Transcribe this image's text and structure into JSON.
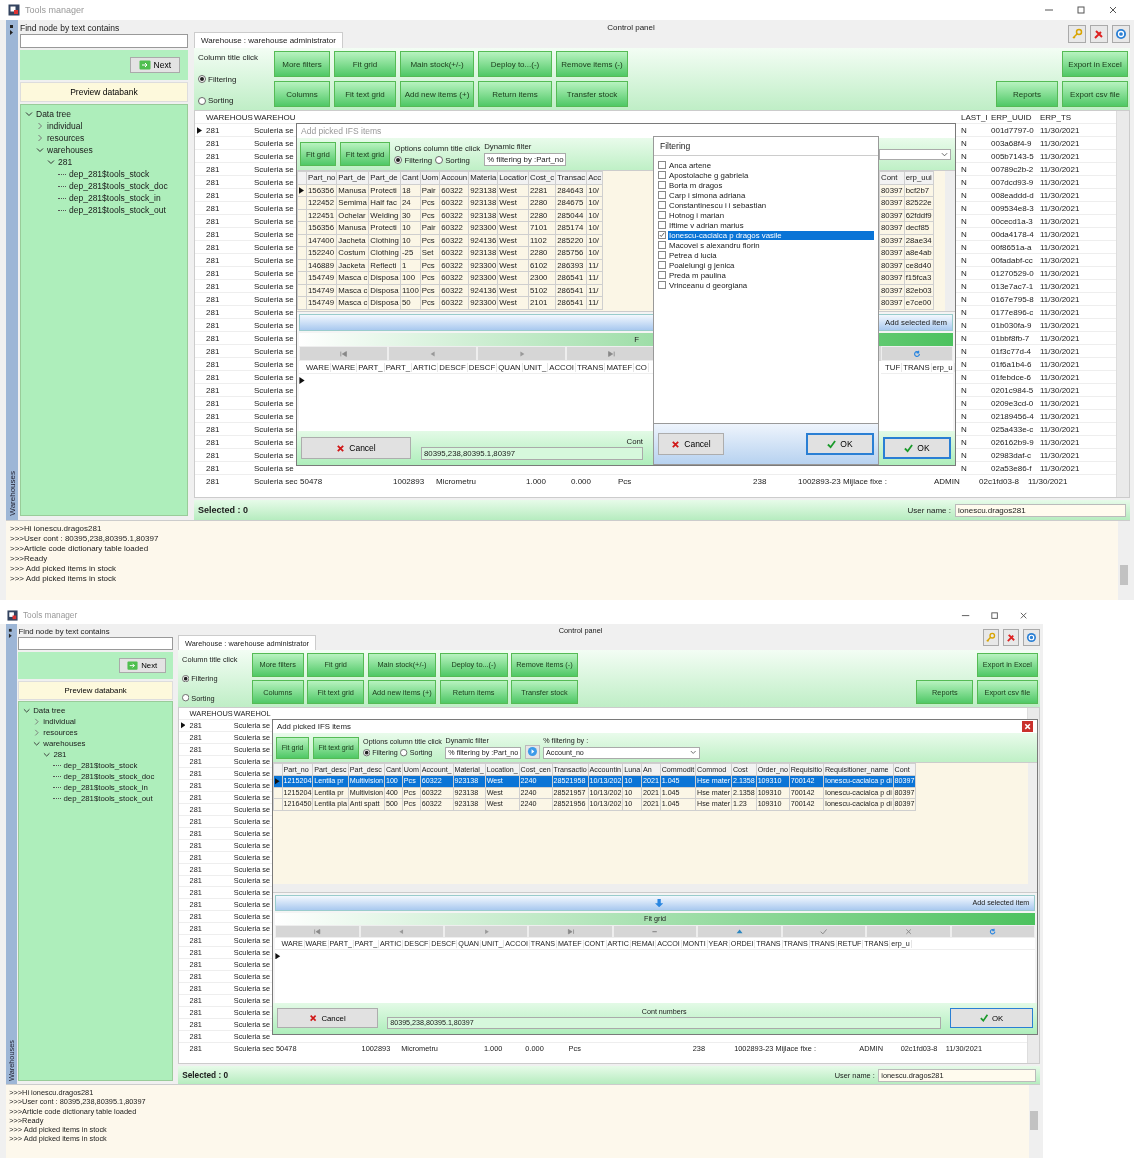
{
  "screens": [
    {
      "title": "Tools manager",
      "strip_label": "Warehouses",
      "sidebar": {
        "find_label": "Find node by text contains",
        "next_label": "Next",
        "preview_label": "Preview databank",
        "tree": [
          {
            "label": "Data tree",
            "expanded": true,
            "children": [
              {
                "label": "individual",
                "expanded": false
              },
              {
                "label": "resources",
                "expanded": false
              },
              {
                "label": "warehouses",
                "expanded": true,
                "children": [
                  {
                    "label": "281",
                    "expanded": true,
                    "children": [
                      {
                        "label": "dep_281$tools_stock"
                      },
                      {
                        "label": "dep_281$tools_stock_doc"
                      },
                      {
                        "label": "dep_281$tools_stock_in"
                      },
                      {
                        "label": "dep_281$tools_stock_out"
                      }
                    ]
                  }
                ]
              }
            ]
          }
        ]
      },
      "panel_title": "Control panel",
      "tab": "Warehouse : warehouse administrator",
      "sort_group": {
        "label": "Column title click",
        "options": [
          {
            "label": "Filtering",
            "selected": true
          },
          {
            "label": "Sorting",
            "selected": false
          }
        ]
      },
      "toolbar_buttons": [
        "More filters",
        "Fit grid",
        "Main stock(+/-)",
        "Deploy to...(-)",
        "Remove items (-)",
        "Columns",
        "Fit text grid",
        "Add new items (+)",
        "Return items",
        "Transfer stock"
      ],
      "side_buttons": [
        "Export in Excel",
        "Reports",
        "Export csv file"
      ],
      "grid": {
        "columns_left": [
          "WAREHOUS",
          "WAREHOU"
        ],
        "columns_right": [
          "LAST_I",
          "ERP_UUID",
          "ERP_TS"
        ],
        "rows": [
          {
            "current": true,
            "cells": [
              "281",
              "Sculeria se"
            ],
            "right": [
              "N",
              "001d7797-0",
              "11/30/2021"
            ]
          },
          {
            "current": false,
            "cells": [
              "281",
              "Sculeria se"
            ],
            "right": [
              "N",
              "003a68f4-9",
              "11/30/2021"
            ]
          },
          {
            "current": false,
            "cells": [
              "281",
              "Sculeria se"
            ],
            "right": [
              "N",
              "005b7143-5",
              "11/30/2021"
            ]
          },
          {
            "current": false,
            "cells": [
              "281",
              "Sculeria se"
            ],
            "right": [
              "N",
              "00789c2b-2",
              "11/30/2021"
            ]
          },
          {
            "current": false,
            "cells": [
              "281",
              "Sculeria se"
            ],
            "right": [
              "N",
              "007dcd93-9",
              "11/30/2021"
            ]
          },
          {
            "current": false,
            "cells": [
              "281",
              "Sculeria se"
            ],
            "right": [
              "N",
              "008eaddd-d",
              "11/30/2021"
            ]
          },
          {
            "current": false,
            "cells": [
              "281",
              "Sculeria se"
            ],
            "right": [
              "N",
              "009534e8-3",
              "11/30/2021"
            ]
          },
          {
            "current": false,
            "cells": [
              "281",
              "Sculeria se"
            ],
            "right": [
              "N",
              "00cecd1a-3",
              "11/30/2021"
            ]
          },
          {
            "current": false,
            "cells": [
              "281",
              "Sculeria se"
            ],
            "right": [
              "N",
              "00da4178-4",
              "11/30/2021"
            ]
          },
          {
            "current": false,
            "cells": [
              "281",
              "Sculeria se"
            ],
            "right": [
              "N",
              "00f8651a-a",
              "11/30/2021"
            ]
          },
          {
            "current": false,
            "cells": [
              "281",
              "Sculeria se"
            ],
            "right": [
              "N",
              "00fadabf-cc",
              "11/30/2021"
            ]
          },
          {
            "current": false,
            "cells": [
              "281",
              "Sculeria se"
            ],
            "right": [
              "N",
              "01270529-0",
              "11/30/2021"
            ]
          },
          {
            "current": false,
            "cells": [
              "281",
              "Sculeria se"
            ],
            "right": [
              "N",
              "013e7ac7-1",
              "11/30/2021"
            ]
          },
          {
            "current": false,
            "cells": [
              "281",
              "Sculeria se"
            ],
            "right": [
              "N",
              "0167e795-8",
              "11/30/2021"
            ]
          },
          {
            "current": false,
            "cells": [
              "281",
              "Sculeria se"
            ],
            "right": [
              "N",
              "0177e896-c",
              "11/30/2021"
            ]
          },
          {
            "current": false,
            "cells": [
              "281",
              "Sculeria se"
            ],
            "right": [
              "N",
              "01b030fa-9",
              "11/30/2021"
            ]
          },
          {
            "current": false,
            "cells": [
              "281",
              "Sculeria se"
            ],
            "right": [
              "N",
              "01bbf8fb-7",
              "11/30/2021"
            ]
          },
          {
            "current": false,
            "cells": [
              "281",
              "Sculeria se"
            ],
            "right": [
              "N",
              "01f3c77d-4",
              "11/30/2021"
            ]
          },
          {
            "current": false,
            "cells": [
              "281",
              "Sculeria se"
            ],
            "right": [
              "N",
              "01f6a1b4-6",
              "11/30/2021"
            ]
          },
          {
            "current": false,
            "cells": [
              "281",
              "Sculeria se"
            ],
            "right": [
              "N",
              "01febdce-6",
              "11/30/2021"
            ]
          },
          {
            "current": false,
            "cells": [
              "281",
              "Sculeria se"
            ],
            "right": [
              "N",
              "0201c984-5",
              "11/30/2021"
            ]
          },
          {
            "current": false,
            "cells": [
              "281",
              "Sculeria se"
            ],
            "right": [
              "N",
              "0209e3cd-0",
              "11/30/2021"
            ]
          },
          {
            "current": false,
            "cells": [
              "281",
              "Sculeria se"
            ],
            "right": [
              "N",
              "02189456-4",
              "11/30/2021"
            ]
          },
          {
            "current": false,
            "cells": [
              "281",
              "Sculeria se"
            ],
            "right": [
              "N",
              "025a433e-c",
              "11/30/2021"
            ]
          },
          {
            "current": false,
            "cells": [
              "281",
              "Sculeria se"
            ],
            "right": [
              "N",
              "026162b9-9",
              "11/30/2021"
            ]
          },
          {
            "current": false,
            "cells": [
              "281",
              "Sculeria se"
            ],
            "right": [
              "N",
              "02983daf-c",
              "11/30/2021"
            ]
          },
          {
            "current": false,
            "cells": [
              "281",
              "Sculeria se"
            ],
            "right": [
              "N",
              "02a53e86-f",
              "11/30/2021"
            ]
          }
        ],
        "last_row": [
          "281",
          "Sculeria sec",
          "50478",
          "1002893",
          "Micrometru",
          "1.000",
          "0.000",
          "Pcs",
          "238",
          "1002893-23 Mijlace fixe :",
          "ADMIN",
          "02c1fd03-8",
          "11/30/2021"
        ]
      },
      "selected_label": "Selected : 0",
      "user_label": "User name :",
      "user_value": "ionescu.dragos281",
      "log": [
        ">>>Hi ionescu.dragos281",
        ">>>User cont : 80395,238,80395.1,80397",
        ">>>Article code dictionary table loaded",
        ">>>Ready",
        ">>> Add picked items in stock",
        ">>> Add picked items in stock"
      ],
      "dialog": {
        "title": "Add picked IFS items",
        "active": false,
        "fit_buttons": [
          "Fit grid",
          "Fit text grid"
        ],
        "options_label": "Options column title click",
        "options": [
          {
            "label": "Filtering",
            "selected": true
          },
          {
            "label": "Sorting",
            "selected": false
          }
        ],
        "filter_label": "Dynamic filter",
        "filter_value": "% filtering by :Part_no",
        "columns": [
          "Part_no",
          "Part_de",
          "Part_de",
          "Cant",
          "Uom",
          "Accoun",
          "Materia",
          "Locatior",
          "Cost_c",
          "Transac",
          "Acc"
        ],
        "columns_after": [
          "Cont",
          "erp_uui"
        ],
        "rows": [
          {
            "current": true,
            "selected": false,
            "cells": [
              "156356",
              "Manusa",
              "Protecti",
              "18",
              "Pair",
              "60322",
              "923138",
              "West",
              "2281",
              "284643",
              "10/"
            ],
            "cells_after": [
              "80397",
              "bcf2b7"
            ]
          },
          {
            "current": false,
            "selected": false,
            "cells": [
              "122452",
              "Semima",
              "Half fac",
              "24",
              "Pcs",
              "60322",
              "923138",
              "West",
              "2280",
              "284675",
              "10/"
            ],
            "cells_after": [
              "80397",
              "82522e"
            ]
          },
          {
            "current": false,
            "selected": false,
            "cells": [
              "122451",
              "Ochelar",
              "Welding",
              "30",
              "Pcs",
              "60322",
              "923138",
              "West",
              "2280",
              "285044",
              "10/"
            ],
            "cells_after": [
              "80397",
              "62fddf9"
            ]
          },
          {
            "current": false,
            "selected": false,
            "cells": [
              "156356",
              "Manusa",
              "Protecti",
              "10",
              "Pair",
              "60322",
              "923300",
              "West",
              "7101",
              "285174",
              "10/"
            ],
            "cells_after": [
              "80397",
              "decf85"
            ]
          },
          {
            "current": false,
            "selected": false,
            "cells": [
              "147400",
              "Jacheta",
              "Clothing",
              "10",
              "Pcs",
              "60322",
              "924136",
              "West",
              "1102",
              "285220",
              "10/"
            ],
            "cells_after": [
              "80397",
              "28ae34"
            ]
          },
          {
            "current": false,
            "selected": false,
            "cells": [
              "152240",
              "Costum",
              "Clothing",
              "-25",
              "Set",
              "60322",
              "923138",
              "West",
              "2280",
              "285756",
              "10/"
            ],
            "cells_after": [
              "80397",
              "a8e4ab"
            ]
          },
          {
            "current": false,
            "selected": false,
            "cells": [
              "146889",
              "Jacketa",
              "Reflecti",
              "1",
              "Pcs",
              "60322",
              "923300",
              "West",
              "6102",
              "286393",
              "11/"
            ],
            "cells_after": [
              "80397",
              "ce8d40"
            ]
          },
          {
            "current": false,
            "selected": false,
            "cells": [
              "154749",
              "Masca c",
              "Disposa",
              "100",
              "Pcs",
              "60322",
              "923300",
              "West",
              "2300",
              "286541",
              "11/"
            ],
            "cells_after": [
              "80397",
              "f15fca3"
            ]
          },
          {
            "current": false,
            "selected": false,
            "cells": [
              "154749",
              "Masca c",
              "Disposa",
              "1100",
              "Pcs",
              "60322",
              "924136",
              "West",
              "5102",
              "286541",
              "11/"
            ],
            "cells_after": [
              "80397",
              "82eb03"
            ]
          },
          {
            "current": false,
            "selected": false,
            "cells": [
              "154749",
              "Masca c",
              "Disposa",
              "50",
              "Pcs",
              "60322",
              "923300",
              "West",
              "2101",
              "286541",
              "11/"
            ],
            "cells_after": [
              "80397",
              "e7ce00"
            ]
          }
        ],
        "add_label": "Add selected item",
        "fit_bar_label": "F",
        "nav": [
          {
            "kind": "first"
          },
          {
            "kind": "prev"
          },
          {
            "kind": "next"
          },
          {
            "kind": "last"
          }
        ],
        "nav_after": [
          {
            "kind": "refresh"
          }
        ],
        "lower_columns": [
          "WARE",
          "WARE",
          "PART_",
          "PART_",
          "ARTIC",
          "DESCF",
          "DESCF",
          "QUAN",
          "UNIT_",
          "ACCOI",
          "TRANS",
          "MATEF",
          "CO"
        ],
        "lower_columns_after": [
          "TUF",
          "TRANS",
          "erp_u"
        ],
        "cancel": "Cancel",
        "cont_label": "Cont",
        "cont_value": "80395,238,80395.1,80397",
        "ok": "OK"
      },
      "popup": {
        "title": "Filtering",
        "items": [
          {
            "label": "Anca artene",
            "checked": false,
            "selected": false
          },
          {
            "label": "Apostolache g gabriela",
            "checked": false,
            "selected": false
          },
          {
            "label": "Borta m dragos",
            "checked": false,
            "selected": false
          },
          {
            "label": "Carp i simona adriana",
            "checked": false,
            "selected": false
          },
          {
            "label": "Constantinescu i i sebastian",
            "checked": false,
            "selected": false
          },
          {
            "label": "Hotnog i marian",
            "checked": false,
            "selected": false
          },
          {
            "label": "Iftime v adrian marius",
            "checked": false,
            "selected": false
          },
          {
            "label": "Ionescu-cacialca p dragos vasile",
            "checked": true,
            "selected": true
          },
          {
            "label": "Macovei s alexandru florin",
            "checked": false,
            "selected": false
          },
          {
            "label": "Petrea d lucia",
            "checked": false,
            "selected": false
          },
          {
            "label": "Poalelungi g jenica",
            "checked": false,
            "selected": false
          },
          {
            "label": "Preda m paulina",
            "checked": false,
            "selected": false
          },
          {
            "label": "Vrinceanu d georgiana",
            "checked": false,
            "selected": false
          }
        ],
        "cancel": "Cancel",
        "ok": "OK"
      }
    },
    {
      "title": "Tools manager",
      "strip_label": "Warehouses",
      "sidebar": {
        "find_label": "Find node by text contains",
        "next_label": "Next",
        "preview_label": "Preview databank",
        "tree": [
          {
            "label": "Data tree",
            "expanded": true,
            "children": [
              {
                "label": "individual",
                "expanded": false
              },
              {
                "label": "resources",
                "expanded": false
              },
              {
                "label": "warehouses",
                "expanded": true,
                "children": [
                  {
                    "label": "281",
                    "expanded": true,
                    "children": [
                      {
                        "label": "dep_281$tools_stock"
                      },
                      {
                        "label": "dep_281$tools_stock_doc"
                      },
                      {
                        "label": "dep_281$tools_stock_in"
                      },
                      {
                        "label": "dep_281$tools_stock_out"
                      }
                    ]
                  }
                ]
              }
            ]
          }
        ]
      },
      "panel_title": "Control panel",
      "tab": "Warehouse : warehouse administrator",
      "sort_group": {
        "label": "Column title click",
        "options": [
          {
            "label": "Filtering",
            "selected": true
          },
          {
            "label": "Sorting",
            "selected": false
          }
        ]
      },
      "toolbar_buttons": [
        "More filters",
        "Fit grid",
        "Main stock(+/-)",
        "Deploy to...(-)",
        "Remove items (-)",
        "Columns",
        "Fit text grid",
        "Add new items (+)",
        "Return items",
        "Transfer stock"
      ],
      "side_buttons": [
        "Export in Excel",
        "Reports",
        "Export csv file"
      ],
      "grid": {
        "columns_left": [
          "WAREHOUS",
          "WAREHOL"
        ],
        "rows": [
          {
            "current": true,
            "cells": [
              "281",
              "Sculeria se"
            ]
          },
          {
            "current": false,
            "cells": [
              "281",
              "Sculeria se"
            ]
          },
          {
            "current": false,
            "cells": [
              "281",
              "Sculeria se"
            ]
          },
          {
            "current": false,
            "cells": [
              "281",
              "Sculeria se"
            ]
          },
          {
            "current": false,
            "cells": [
              "281",
              "Sculeria se"
            ]
          },
          {
            "current": false,
            "cells": [
              "281",
              "Sculeria se"
            ]
          },
          {
            "current": false,
            "cells": [
              "281",
              "Sculeria se"
            ]
          },
          {
            "current": false,
            "cells": [
              "281",
              "Sculeria se"
            ]
          },
          {
            "current": false,
            "cells": [
              "281",
              "Sculeria se"
            ]
          },
          {
            "current": false,
            "cells": [
              "281",
              "Sculeria se"
            ]
          },
          {
            "current": false,
            "cells": [
              "281",
              "Sculeria se"
            ]
          },
          {
            "current": false,
            "cells": [
              "281",
              "Sculeria se"
            ]
          },
          {
            "current": false,
            "cells": [
              "281",
              "Sculeria se"
            ]
          },
          {
            "current": false,
            "cells": [
              "281",
              "Sculeria se"
            ]
          },
          {
            "current": false,
            "cells": [
              "281",
              "Sculeria se"
            ]
          },
          {
            "current": false,
            "cells": [
              "281",
              "Sculeria se"
            ]
          },
          {
            "current": false,
            "cells": [
              "281",
              "Sculeria se"
            ]
          },
          {
            "current": false,
            "cells": [
              "281",
              "Sculeria se"
            ]
          },
          {
            "current": false,
            "cells": [
              "281",
              "Sculeria se"
            ]
          },
          {
            "current": false,
            "cells": [
              "281",
              "Sculeria se"
            ]
          },
          {
            "current": false,
            "cells": [
              "281",
              "Sculeria se"
            ]
          },
          {
            "current": false,
            "cells": [
              "281",
              "Sculeria se"
            ]
          },
          {
            "current": false,
            "cells": [
              "281",
              "Sculeria se"
            ]
          },
          {
            "current": false,
            "cells": [
              "281",
              "Sculeria se"
            ]
          },
          {
            "current": false,
            "cells": [
              "281",
              "Sculeria se"
            ]
          },
          {
            "current": false,
            "cells": [
              "281",
              "Sculeria se"
            ]
          },
          {
            "current": false,
            "cells": [
              "281",
              "Sculeria se"
            ]
          }
        ],
        "last_row": [
          "281",
          "Sculeria sec",
          "50478",
          "1002893",
          "Micrometru",
          "1.000",
          "0.000",
          "Pcs",
          "238",
          "1002893-23 Mijlace fixe :",
          "ADMIN",
          "02c1fd03-8",
          "11/30/2021"
        ]
      },
      "selected_label": "Selected : 0",
      "user_label": "User name :",
      "user_value": "ionescu.dragos281",
      "log": [
        ">>>Hi ionescu.dragos281",
        ">>>User cont : 80395,238,80395.1,80397",
        ">>>Article code dictionary table loaded",
        ">>>Ready",
        ">>> Add picked items in stock",
        ">>> Add picked items in stock"
      ],
      "dialog": {
        "title": "Add picked IFS items",
        "active": true,
        "fit_buttons": [
          "Fit grid",
          "Fit text grid"
        ],
        "options_label": "Options column title click",
        "options": [
          {
            "label": "Filtering",
            "selected": true
          },
          {
            "label": "Sorting",
            "selected": false
          }
        ],
        "filter_label": "Dynamic filter",
        "filter_value": "% filtering by :Part_no",
        "combo": {
          "label": "% filtering by :",
          "value": "Account_no"
        },
        "columns": [
          "Part_no",
          "Part_desc",
          "Part_desc",
          "Cant",
          "Uom",
          "Account_",
          "Material_",
          "Location_",
          "Cost_cen",
          "Transactio",
          "Accountin",
          "Luna",
          "An",
          "Commodit",
          "Commod",
          "Cost",
          "Order_no",
          "Requisitio",
          "Requisitioner_name",
          "Cont"
        ],
        "rows": [
          {
            "current": true,
            "selected": true,
            "cells": [
              "1215204",
              "Lentila pr",
              "Multivision",
              "100",
              "Pcs",
              "60322",
              "923138",
              "West",
              "2240",
              "28521958",
              "10/13/202",
              "10",
              "2021",
              "1.045",
              "Hse mater",
              "2.1358",
              "109310",
              "700142",
              "Ionescu-cacialca p di",
              "80397"
            ]
          },
          {
            "current": false,
            "selected": false,
            "cells": [
              "1215204",
              "Lentila pr",
              "Multivision",
              "400",
              "Pcs",
              "60322",
              "923138",
              "West",
              "2240",
              "28521957",
              "10/13/202",
              "10",
              "2021",
              "1.045",
              "Hse mater",
              "2.1358",
              "109310",
              "700142",
              "Ionescu-cacialca p di",
              "80397"
            ]
          },
          {
            "current": false,
            "selected": false,
            "cells": [
              "1216450",
              "Lentila pla",
              "Anti spatt",
              "500",
              "Pcs",
              "60322",
              "923138",
              "West",
              "2240",
              "28521956",
              "10/13/202",
              "10",
              "2021",
              "1.045",
              "Hse mater",
              "1.23",
              "109310",
              "700142",
              "Ionescu-cacialca p di",
              "80397"
            ]
          }
        ],
        "add_label": "Add selected item",
        "fit_bar_label": "Fit grid",
        "nav": [
          {
            "kind": "first"
          },
          {
            "kind": "prev"
          },
          {
            "kind": "next"
          },
          {
            "kind": "last"
          },
          {
            "kind": "delete"
          },
          {
            "kind": "post"
          },
          {
            "kind": "confirm"
          },
          {
            "kind": "cancel"
          },
          {
            "kind": "refresh"
          }
        ],
        "lower_columns": [
          "WARE",
          "WARE",
          "PART_",
          "PART_",
          "ARTIC",
          "DESCF",
          "DESCF",
          "QUAN",
          "UNIT_",
          "ACCOI",
          "TRANS",
          "MATEF",
          "CONT",
          "ARTIC",
          "REMAI",
          "ACCOI",
          "MONTI",
          "YEAR",
          "ORDEI",
          "TRANS",
          "TRANS",
          "TRANS",
          "RETUF",
          "TRANS",
          "erp_u"
        ],
        "cancel": "Cancel",
        "cont_label": "Cont numbers",
        "cont_value": "80395,238,80395.1,80397",
        "ok": "OK"
      }
    }
  ]
}
